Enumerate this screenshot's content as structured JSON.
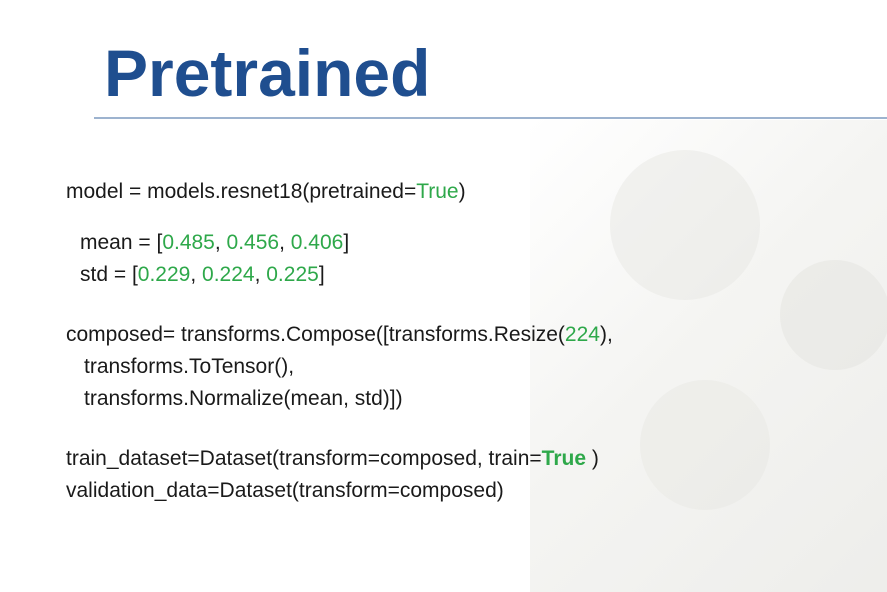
{
  "slide": {
    "title": "Pretrained"
  },
  "code": {
    "model_line": {
      "pre": "model = models.resnet18(pretrained=",
      "arg": "True",
      "post": ")"
    },
    "mean_line": {
      "pre": "mean = [",
      "v1": "0.485",
      "sep1": ", ",
      "v2": "0.456",
      "sep2": ", ",
      "v3": "0.406",
      "post": "]"
    },
    "std_line": {
      "pre": "std = [",
      "v1": "0.229",
      "sep1": ", ",
      "v2": "0.224",
      "sep2": ", ",
      "v3": "0.225",
      "post": "]"
    },
    "composed_line1": {
      "pre": "composed= transforms.Compose([transforms.Resize(",
      "arg": "224",
      "post": "),"
    },
    "composed_line2": "transforms.ToTensor(),",
    "composed_line3": "transforms.Normalize(mean, std)])",
    "train_line": {
      "pre": "train_dataset=Dataset(transform=composed, train=",
      "arg": "True",
      "post": " )"
    },
    "validation_line": "validation_data=Dataset(transform=composed)"
  },
  "colors": {
    "title": "#1f4e8f",
    "rule": "#9db3cf",
    "keyword_green": "#2ea84a",
    "text": "#1a1a1a"
  }
}
